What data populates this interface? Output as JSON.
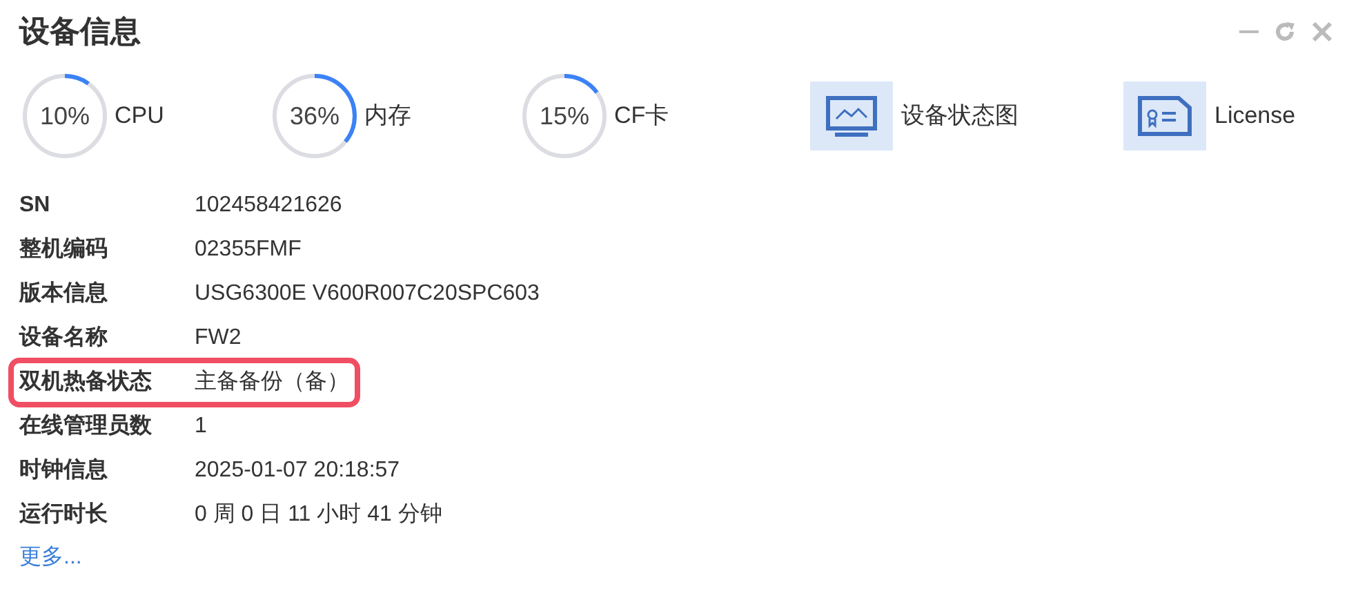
{
  "panel": {
    "title": "设备信息"
  },
  "gauges": [
    {
      "value": "10%",
      "label": "CPU"
    },
    {
      "value": "36%",
      "label": "内存"
    },
    {
      "value": "15%",
      "label": "CF卡"
    }
  ],
  "shortcuts": [
    {
      "kind": "monitor",
      "label": "设备状态图"
    },
    {
      "kind": "certificate",
      "label": "License"
    }
  ],
  "rows": [
    {
      "label": "SN",
      "value": "102458421626",
      "highlighted": false
    },
    {
      "label": "整机编码",
      "value": "02355FMF",
      "highlighted": false
    },
    {
      "label": "版本信息",
      "value": "USG6300E V600R007C20SPC603",
      "highlighted": false
    },
    {
      "label": "设备名称",
      "value": "FW2",
      "highlighted": false
    },
    {
      "label": "双机热备状态",
      "value": "主备备份（备）",
      "highlighted": true
    },
    {
      "label": "在线管理员数",
      "value": "1",
      "highlighted": false
    },
    {
      "label": "时钟信息",
      "value": "2025-01-07 20:18:57",
      "highlighted": false
    },
    {
      "label": "运行时长",
      "value": "0 周 0 日 11 小时 41 分钟",
      "highlighted": false
    }
  ],
  "more_link": "更多..."
}
